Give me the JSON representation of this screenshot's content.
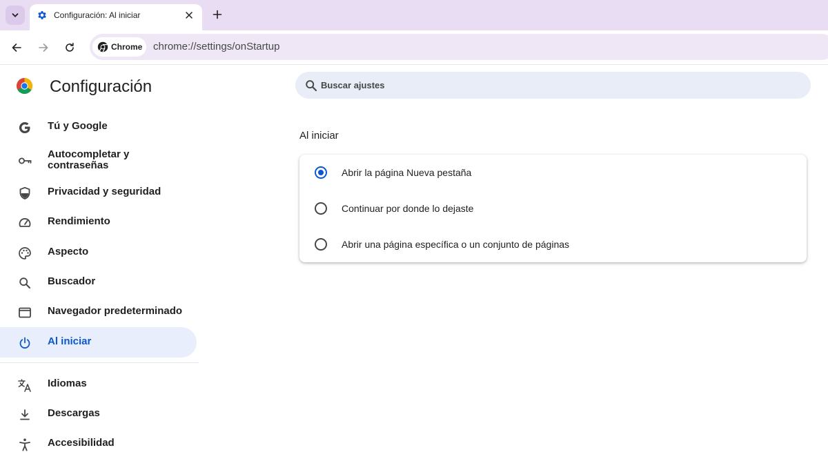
{
  "tab": {
    "title": "Configuración: Al iniciar"
  },
  "omnibox": {
    "chip_label": "Chrome",
    "url": "chrome://settings/onStartup"
  },
  "sidebar": {
    "title": "Configuración",
    "items": [
      {
        "label": "Tú y Google",
        "icon": "google-icon"
      },
      {
        "label": "Autocompletar y contraseñas",
        "icon": "key-icon"
      },
      {
        "label": "Privacidad y seguridad",
        "icon": "shield-icon"
      },
      {
        "label": "Rendimiento",
        "icon": "speedometer-icon"
      },
      {
        "label": "Aspecto",
        "icon": "palette-icon"
      },
      {
        "label": "Buscador",
        "icon": "search-icon"
      },
      {
        "label": "Navegador predeterminado",
        "icon": "browser-window-icon"
      },
      {
        "label": "Al iniciar",
        "icon": "power-icon",
        "active": true
      },
      {
        "label": "Idiomas",
        "icon": "translate-icon"
      },
      {
        "label": "Descargas",
        "icon": "download-icon"
      },
      {
        "label": "Accesibilidad",
        "icon": "accessibility-icon"
      }
    ]
  },
  "search": {
    "placeholder": "Buscar ajustes"
  },
  "startup": {
    "section_title": "Al iniciar",
    "selected_option": 0,
    "options": [
      {
        "label": "Abrir la página Nueva pestaña"
      },
      {
        "label": "Continuar por donde lo dejaste"
      },
      {
        "label": "Abrir una página específica o un conjunto de páginas"
      }
    ]
  },
  "colors": {
    "tabstrip_bg": "#e9ddf4",
    "accent": "#0b57d0",
    "active_nav_bg": "#e8eefb",
    "search_bg": "#e9edf7"
  }
}
